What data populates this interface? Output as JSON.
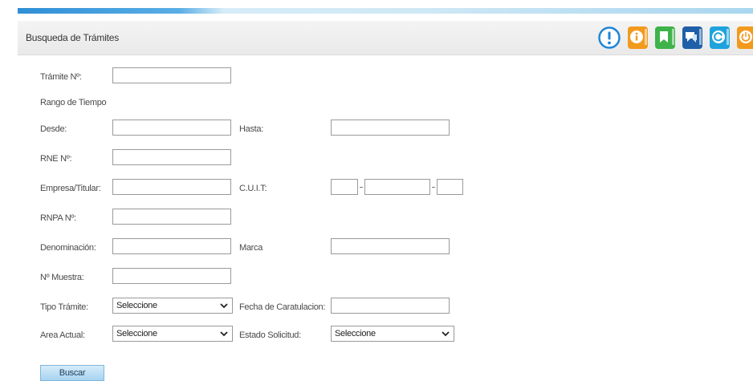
{
  "header": {
    "title": "Busqueda de Trámites",
    "icons": [
      "alert-icon",
      "info-icon",
      "flag-icon",
      "message-icon",
      "reload-icon",
      "power-icon"
    ]
  },
  "form": {
    "tramite_label": "Trámite Nº:",
    "rango_label": "Rango de Tiempo",
    "desde_label": "Desde:",
    "hasta_label": "Hasta:",
    "rne_label": "RNE Nº:",
    "empresa_label": "Empresa/Titular:",
    "cuit_label": "C.U.I.T:",
    "rnpa_label": "RNPA Nº:",
    "denominacion_label": "Denominación:",
    "marca_label": "Marca",
    "muestra_label": "Nº Muestra:",
    "tipo_tramite_label": "Tipo Trámite:",
    "tipo_tramite_value": "Seleccione",
    "fecha_label": "Fecha de Caratulacion:",
    "area_label": "Area Actual:",
    "area_value": "Seleccione",
    "estado_label": "Estado Solicitud:",
    "estado_value": "Seleccione",
    "buscar_label": "Buscar"
  },
  "colors": {
    "accent_orange": "#f29a1e",
    "accent_green": "#3fb34a",
    "accent_navy": "#1f5fa8",
    "accent_cyan": "#1fa3dd",
    "alert_blue": "#1f86d6"
  }
}
